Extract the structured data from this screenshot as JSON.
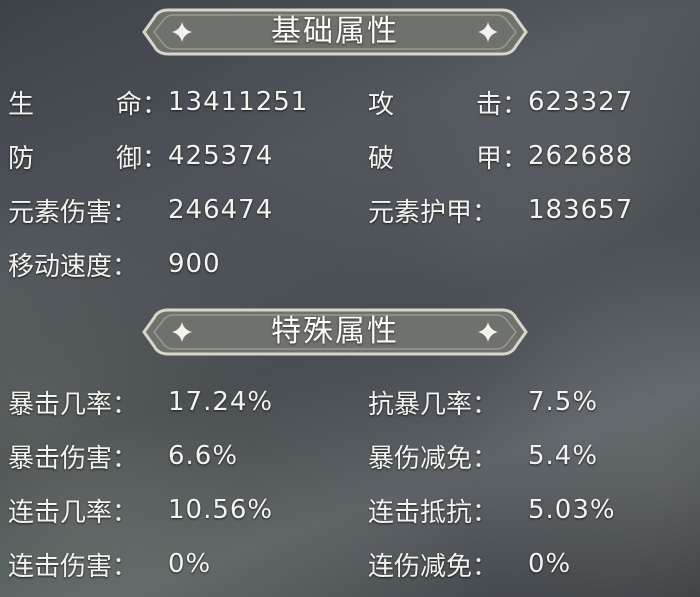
{
  "basic_section": {
    "title": "基础属性",
    "stats": [
      {
        "label_chars": [
          "生",
          "命："
        ],
        "value": "13411251"
      },
      {
        "label_chars": [
          "攻",
          "击："
        ],
        "value": "623327"
      },
      {
        "label_chars": [
          "防",
          "御："
        ],
        "value": "425374"
      },
      {
        "label_chars": [
          "破",
          "甲："
        ],
        "value": "262688"
      },
      {
        "label": "元素伤害：",
        "value": "246474"
      },
      {
        "label": "元素护甲：",
        "value": "183657"
      },
      {
        "label": "移动速度：",
        "value": "900"
      }
    ]
  },
  "special_section": {
    "title": "特殊属性",
    "stats": [
      {
        "label": "暴击几率：",
        "value": "17.24%"
      },
      {
        "label": "抗暴几率：",
        "value": "7.5%"
      },
      {
        "label": "暴击伤害：",
        "value": "6.6%"
      },
      {
        "label": "暴伤减免：",
        "value": "5.4%"
      },
      {
        "label": "连击几率：",
        "value": "10.56%"
      },
      {
        "label": "连击抵抗：",
        "value": "5.03%"
      },
      {
        "label": "连击伤害：",
        "value": "0%"
      },
      {
        "label": "连伤减免：",
        "value": "0%"
      }
    ]
  },
  "colors": {
    "banner_fill": "#6f716c",
    "banner_border": "#d8d6cc",
    "text": "#f3f3f0"
  },
  "icons": {
    "banner_ornament": "four-point-sparkle-icon"
  }
}
